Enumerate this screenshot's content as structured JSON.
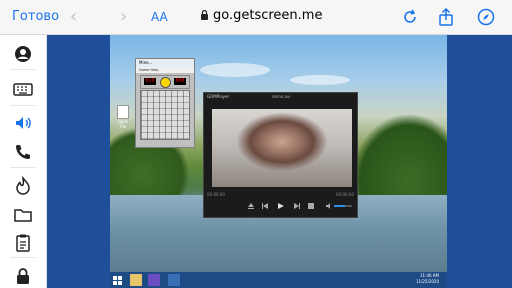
{
  "browser": {
    "done_label": "Готово",
    "back": "‹",
    "forward": "›",
    "text_size": "AA",
    "url": "go.getscreen.me",
    "reload_icon": "reload-icon",
    "share_icon": "share-icon",
    "compass_icon": "compass-icon"
  },
  "sidebar": {
    "items": [
      {
        "name": "user-icon"
      },
      {
        "name": "keyboard-icon"
      },
      {
        "name": "volume-icon"
      },
      {
        "name": "phone-icon"
      },
      {
        "name": "fire-icon"
      },
      {
        "name": "folder-icon"
      },
      {
        "name": "clipboard-icon"
      },
      {
        "name": "lock-icon"
      }
    ]
  },
  "remote": {
    "minesweeper": {
      "title": "Mine...",
      "menu": "Game  Help",
      "mines_left": "010",
      "timer": "000"
    },
    "shortcut_label": "Open File",
    "player": {
      "app": "GOMPlayer",
      "file": "demo.avi",
      "time_left": "00:00:00",
      "time_right": "00:00:00"
    },
    "taskbar": {
      "time": "11:46 AM",
      "date": "11/25/2020"
    }
  },
  "colors": {
    "accent": "#1a73e8",
    "remote_bg": "#1f4e9a"
  }
}
